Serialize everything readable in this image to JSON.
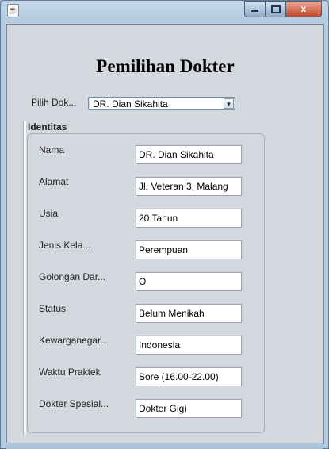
{
  "window": {
    "icon": "java-icon",
    "controls": {
      "minimize": "minimize-icon",
      "maximize": "maximize-icon",
      "close": "close-icon",
      "close_glyph": "x"
    }
  },
  "page_title": "Pemilihan Dokter",
  "selector": {
    "label": "Pilih Dok...",
    "selected": "DR. Dian Sikahita",
    "arrow": "▼"
  },
  "group": {
    "title": "Identitas",
    "rows": [
      {
        "label": "Nama",
        "value": "DR. Dian Sikahita"
      },
      {
        "label": "Alamat",
        "value": "Jl. Veteran 3, Malang"
      },
      {
        "label": "Usia",
        "value": "20 Tahun"
      },
      {
        "label": "Jenis Kela...",
        "value": "Perempuan"
      },
      {
        "label": "Golongan Dar...",
        "value": "O"
      },
      {
        "label": "Status",
        "value": "Belum Menikah"
      },
      {
        "label": "Kewarganegar...",
        "value": "Indonesia"
      },
      {
        "label": "Waktu Praktek",
        "value": " Sore (16.00-22.00)"
      },
      {
        "label": "Dokter Spesial...",
        "value": "Dokter Gigi"
      }
    ]
  }
}
